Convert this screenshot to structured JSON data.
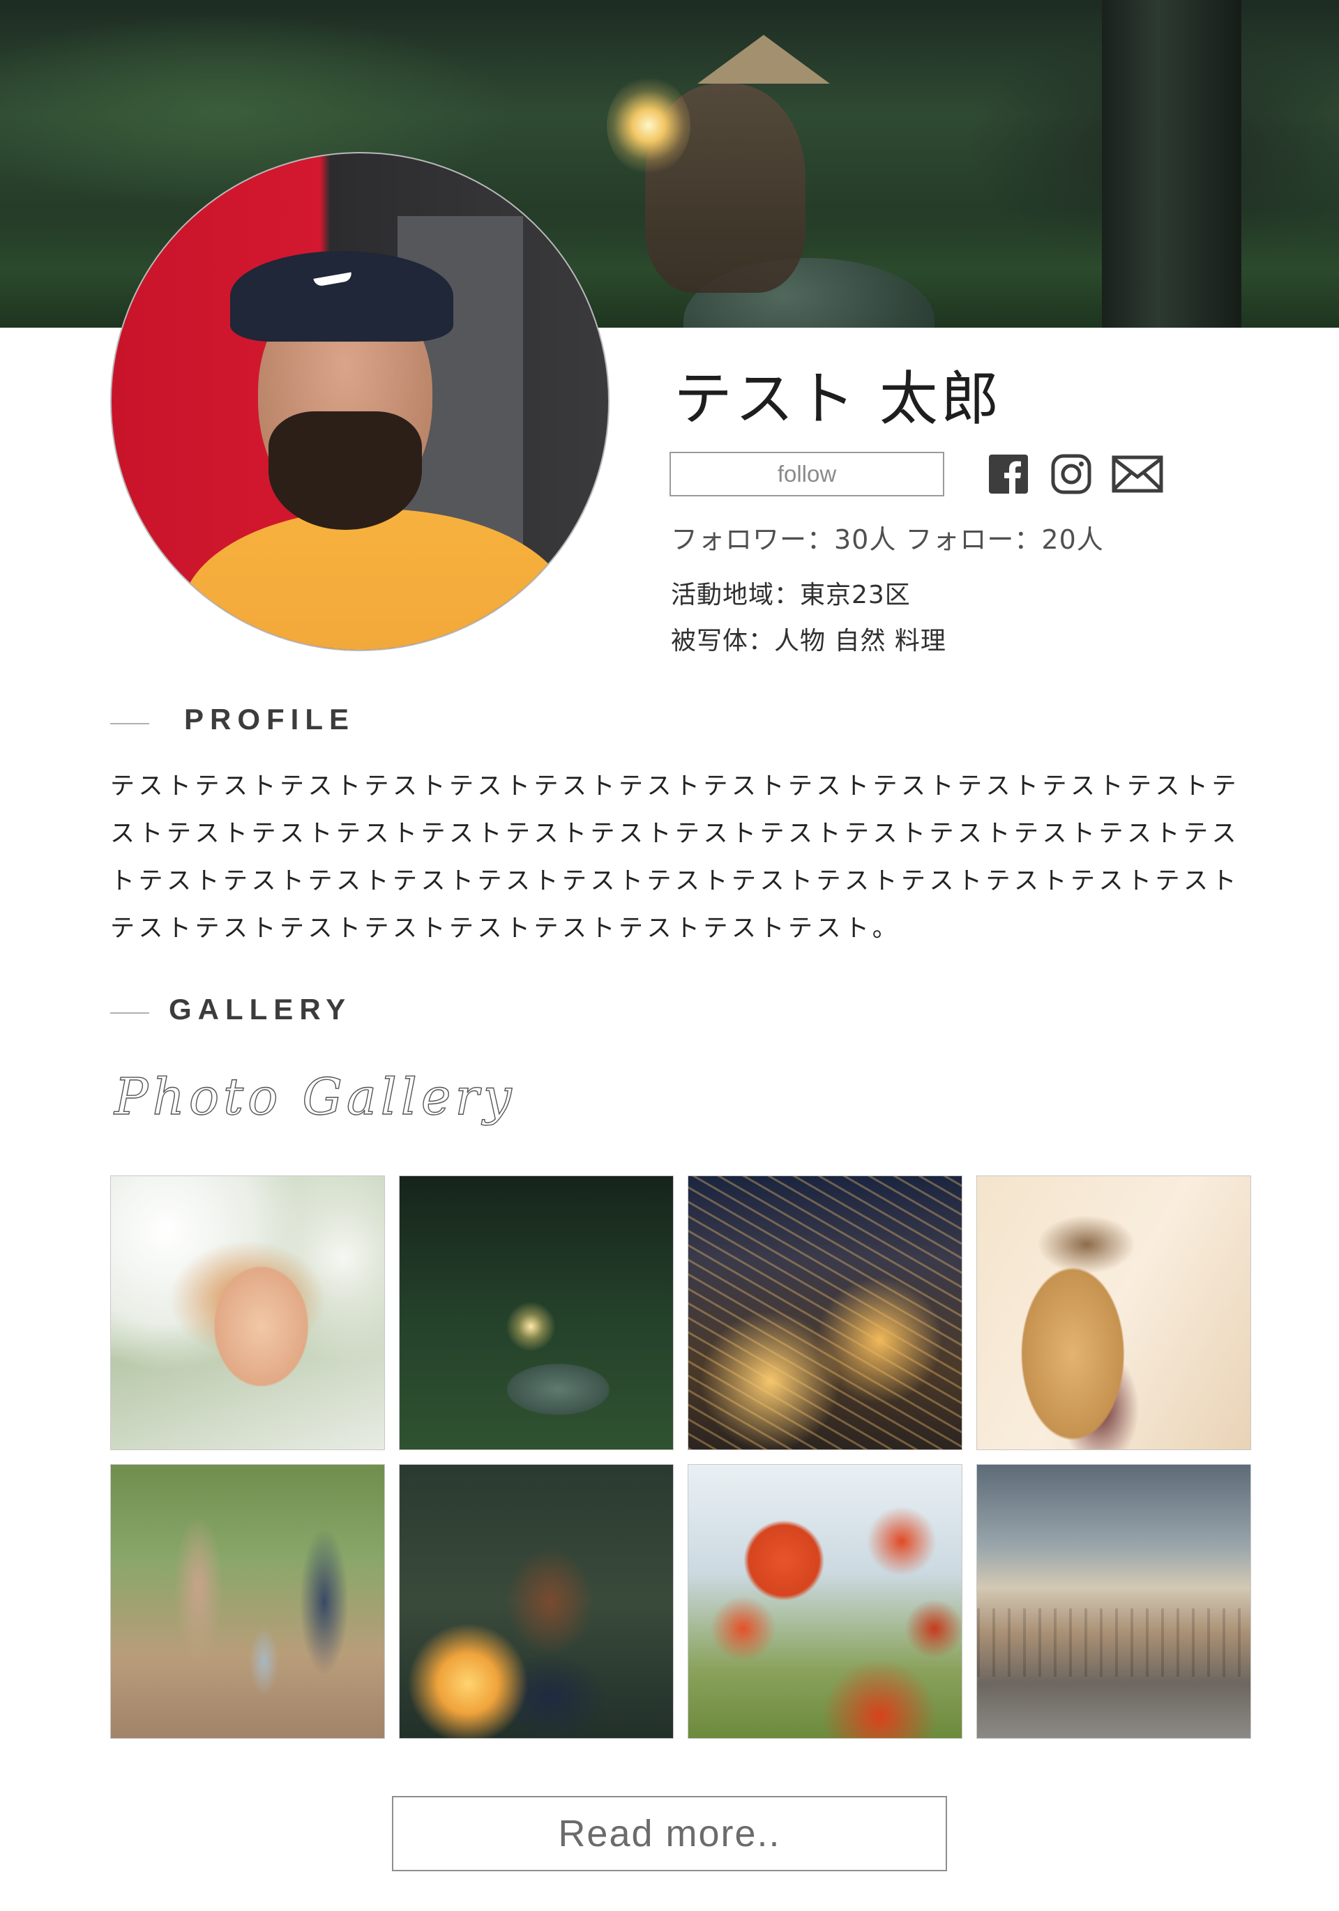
{
  "profile": {
    "name": "テスト 太郎",
    "follow_label": "follow",
    "stats": "フォロワー：30人 フォロー：20人",
    "area": "活動地域：東京23区",
    "subjects": "被写体：人物 自然 料理"
  },
  "social": {
    "facebook_icon": "facebook-icon",
    "instagram_icon": "instagram-icon",
    "mail_icon": "mail-icon",
    "color": "#3d3d3d"
  },
  "sections": {
    "profile_title": "PROFILE",
    "profile_text": "テストテストテストテストテストテストテストテストテストテストテストテストテストテストテストテストテストテストテストテストテストテストテストテストテストテストテストテストテストテストテストテストテストテストテストテストテストテストテストテストテストテストテストテストテストテストテストテストテスト。",
    "gallery_title": "GALLERY",
    "gallery_script": "Photo Gallery"
  },
  "gallery": {
    "photos": [
      {
        "subject": "woman-among-white-flowers"
      },
      {
        "subject": "boy-with-lantern-on-rock"
      },
      {
        "subject": "city-at-night"
      },
      {
        "subject": "woman-in-hat-sunlight"
      },
      {
        "subject": "family-walking-path"
      },
      {
        "subject": "child-with-glowing-jar"
      },
      {
        "subject": "red-poppies"
      },
      {
        "subject": "city-street-cloudy-sky"
      }
    ]
  },
  "actions": {
    "read_more": "Read more.."
  }
}
